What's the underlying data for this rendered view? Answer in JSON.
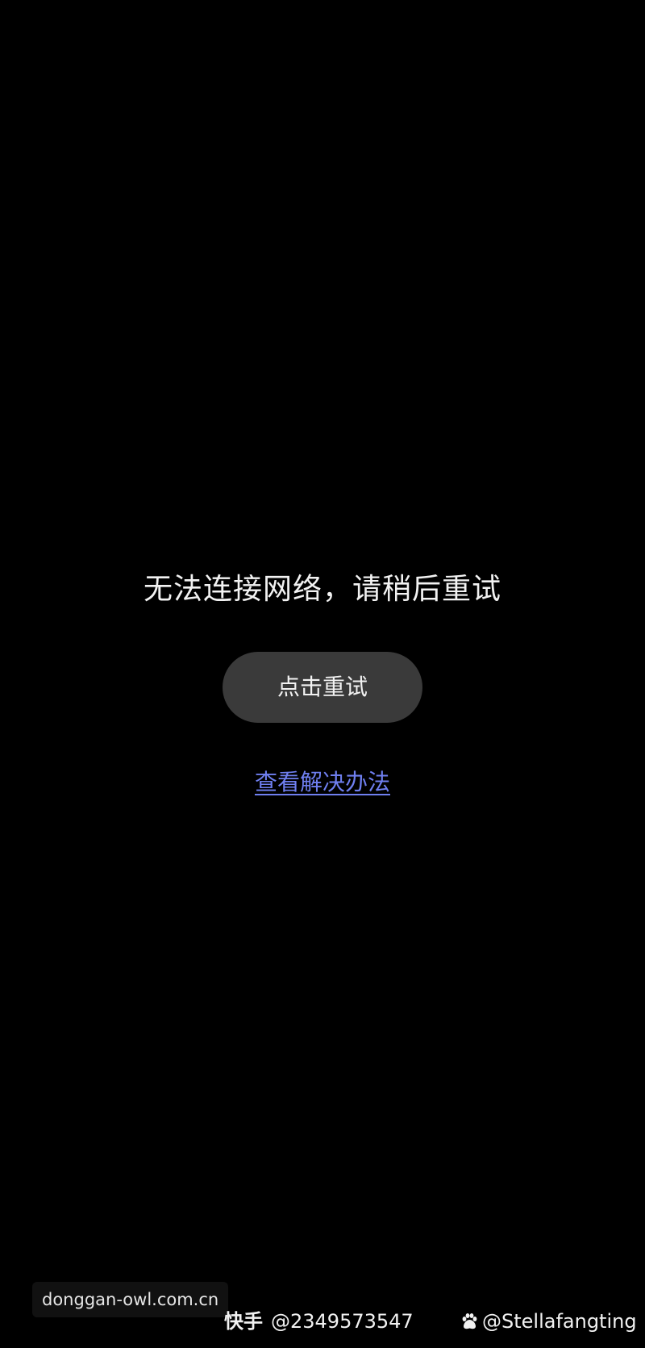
{
  "error": {
    "message": "无法连接网络，请稍后重试",
    "retry_label": "点击重试",
    "solutions_link": "查看解决办法"
  },
  "watermarks": {
    "site": "donggan-owl.com.cn",
    "kuaishou_brand": "快手",
    "kuaishou_id": "@2349573547",
    "baidu_handle": "@Stellafangting",
    "baidu_icon": "paw-icon"
  },
  "colors": {
    "background": "#000000",
    "button_bg": "#3a3a3a",
    "link": "#6f7ff0",
    "text": "#f2f2f2"
  }
}
